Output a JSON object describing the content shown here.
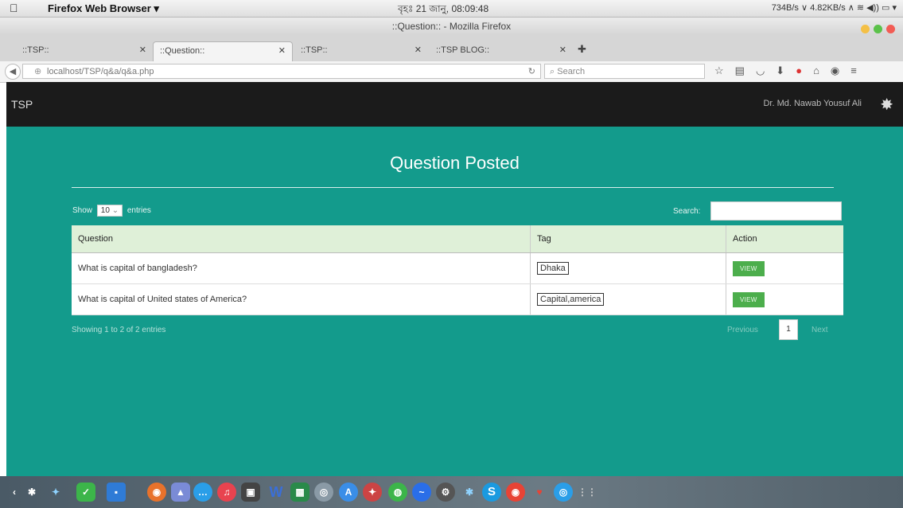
{
  "menubar": {
    "app_name": "Firefox Web Browser ▾",
    "clock": "বৃহঃ 21 জানু, 08:09:48",
    "status": "734B/s ∨ 4.82KB/s ∧ ≋ ◀)) ▭ ▾"
  },
  "window": {
    "title": "::Question:: - Mozilla Firefox"
  },
  "tabs": [
    {
      "label": "::TSP::"
    },
    {
      "label": "::Question::"
    },
    {
      "label": "::TSP::"
    },
    {
      "label": "::TSP BLOG::"
    }
  ],
  "navbar": {
    "url": "localhost/TSP/q&a/q&a.php",
    "search_placeholder": "Search"
  },
  "site": {
    "brand": "TSP",
    "user": "Dr. Md. Nawab Yousuf Ali"
  },
  "main": {
    "title": "Question Posted",
    "show_prefix": "Show",
    "entries_value": "10",
    "show_suffix": "entries",
    "search_label": "Search:",
    "columns": [
      "Question",
      "Tag",
      "Action"
    ],
    "rows": [
      {
        "question": "What is capital of bangladesh?",
        "tag": "Dhaka",
        "action": "VIEW"
      },
      {
        "question": "What is capital of United states of America?",
        "tag": "Capital,america",
        "action": "VIEW"
      }
    ],
    "showing": "Showing 1 to 2 of 2 entries",
    "previous": "Previous",
    "page": "1",
    "next": "Next"
  },
  "colors": {
    "page_bg": "#139b8c",
    "topnav_bg": "#1b1b1b",
    "table_header": "#dff0d8",
    "view_button": "#4cae4c"
  }
}
